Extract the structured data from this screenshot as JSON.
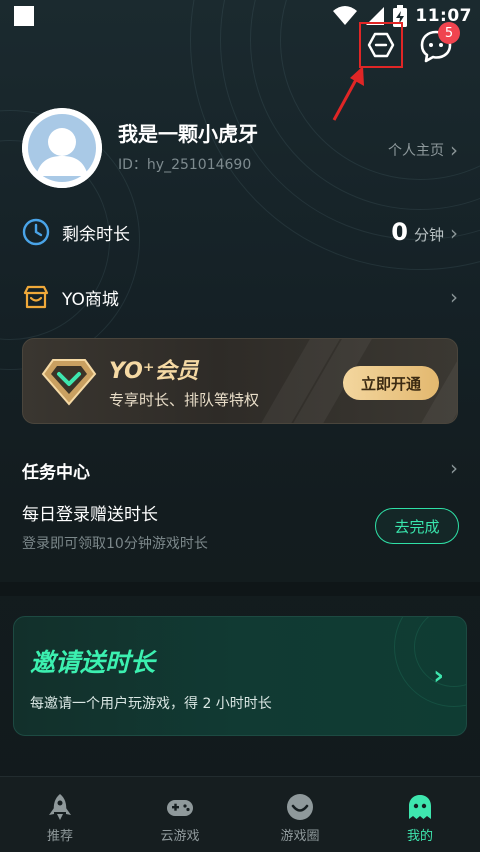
{
  "status_bar": {
    "time": "11:07"
  },
  "header": {
    "notification_count": "5"
  },
  "profile": {
    "username": "我是一颗小虎牙",
    "user_id": "ID：hy_251014690",
    "homepage_label": "个人主页"
  },
  "remaining_time": {
    "label": "剩余时长",
    "value": "0",
    "unit": "分钟"
  },
  "shop": {
    "label": "YO商城"
  },
  "vip": {
    "title": "YO⁺会员",
    "subtitle": "专享时长、排队等特权",
    "button_label": "立即开通",
    "accent_color": "#f3d69e"
  },
  "tasks": {
    "section_title": "任务中心",
    "items": [
      {
        "name": "每日登录赠送时长",
        "description": "登录即可领取10分钟游戏时长",
        "button_label": "去完成"
      }
    ]
  },
  "invite": {
    "title": "邀请送时长",
    "subtitle": "每邀请一个用户玩游戏，得 2 小时时长",
    "accent_color": "#3cf0b0"
  },
  "bottom_nav": {
    "items": [
      {
        "label": "推荐",
        "icon": "rocket-icon"
      },
      {
        "label": "云游戏",
        "icon": "gamepad-icon"
      },
      {
        "label": "游戏圈",
        "icon": "smile-icon"
      },
      {
        "label": "我的",
        "icon": "ghost-icon",
        "active": true
      }
    ]
  },
  "colors": {
    "brand_green": "#3ee6ae",
    "badge_red": "#f0444f",
    "highlight_red": "#e02626"
  }
}
